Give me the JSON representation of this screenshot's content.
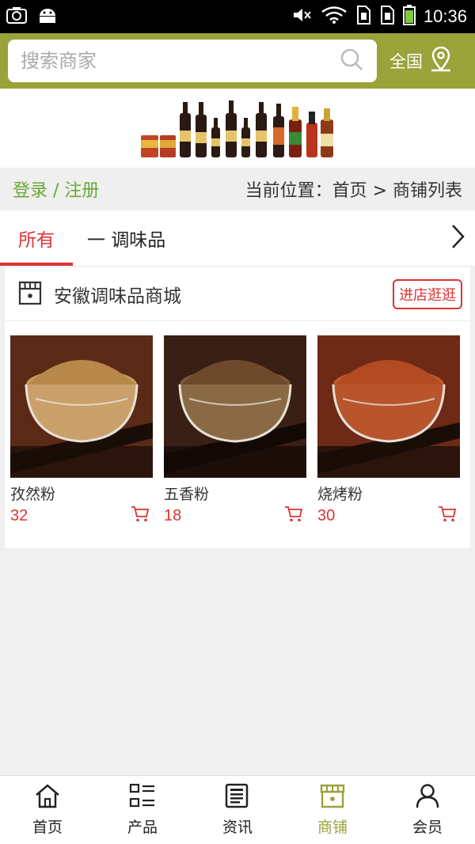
{
  "status_bar": {
    "time": "10:36",
    "icons": [
      "screenshot-icon",
      "android-icon",
      "mute-icon",
      "wifi-icon",
      "sim1-icon",
      "sim2-icon",
      "battery-icon"
    ]
  },
  "header": {
    "search_placeholder": "搜索商家",
    "region_label": "全国",
    "accent_color": "#9aa23a"
  },
  "breadcrumb": {
    "login_label": "登录 / 注册",
    "location_text": "当前位置：首页 > 商铺列表"
  },
  "tabs": {
    "all_label": "所有",
    "category_label": "一 调味品"
  },
  "shop": {
    "name": "安徽调味品商城",
    "visit_label": "进店逛逛",
    "products": [
      {
        "name": "孜然粉",
        "price": "32"
      },
      {
        "name": "五香粉",
        "price": "18"
      },
      {
        "name": "烧烤粉",
        "price": "30"
      }
    ]
  },
  "bottom_nav": {
    "items": [
      {
        "label": "首页",
        "icon": "home-icon"
      },
      {
        "label": "产品",
        "icon": "grid-list-icon"
      },
      {
        "label": "资讯",
        "icon": "news-icon"
      },
      {
        "label": "商铺",
        "icon": "shop-icon",
        "active": true
      },
      {
        "label": "会员",
        "icon": "user-icon"
      }
    ]
  }
}
